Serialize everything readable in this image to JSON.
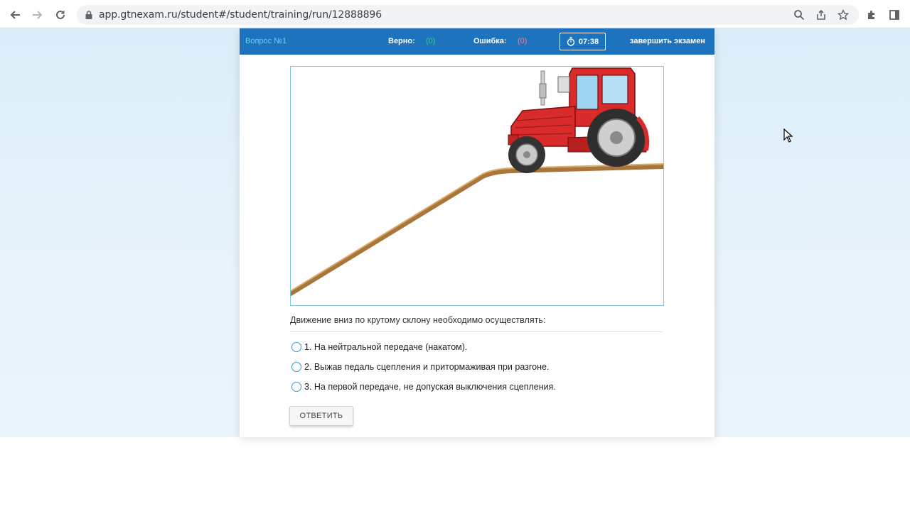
{
  "browser": {
    "url": "app.gtnexam.ru/student#/student/training/run/12888896"
  },
  "exam_bar": {
    "question_label": "Вопрос №1",
    "correct_label": "Верно:",
    "correct_count": "(0)",
    "error_label": "Ошибка:",
    "error_count": "(0)",
    "timer": "07:38",
    "finish_label": "завершить экзамен",
    "colors": {
      "bar": "#1e73be",
      "question_label": "#61d4f2",
      "correct_count": "#30d07a",
      "error_count": "#f47a8c"
    }
  },
  "question": {
    "text": "Движение вниз по крутому склону необходимо осуществлять:",
    "image_icon": "tractor-on-slope"
  },
  "options": [
    {
      "label": "1. На нейтральной передаче (накатом)."
    },
    {
      "label": "2. Выжав педаль сцепления и притормаживая при разгоне."
    },
    {
      "label": "3. На первой передаче, не допуская выключения сцепления."
    }
  ],
  "answer_button": "ОТВЕТИТЬ"
}
